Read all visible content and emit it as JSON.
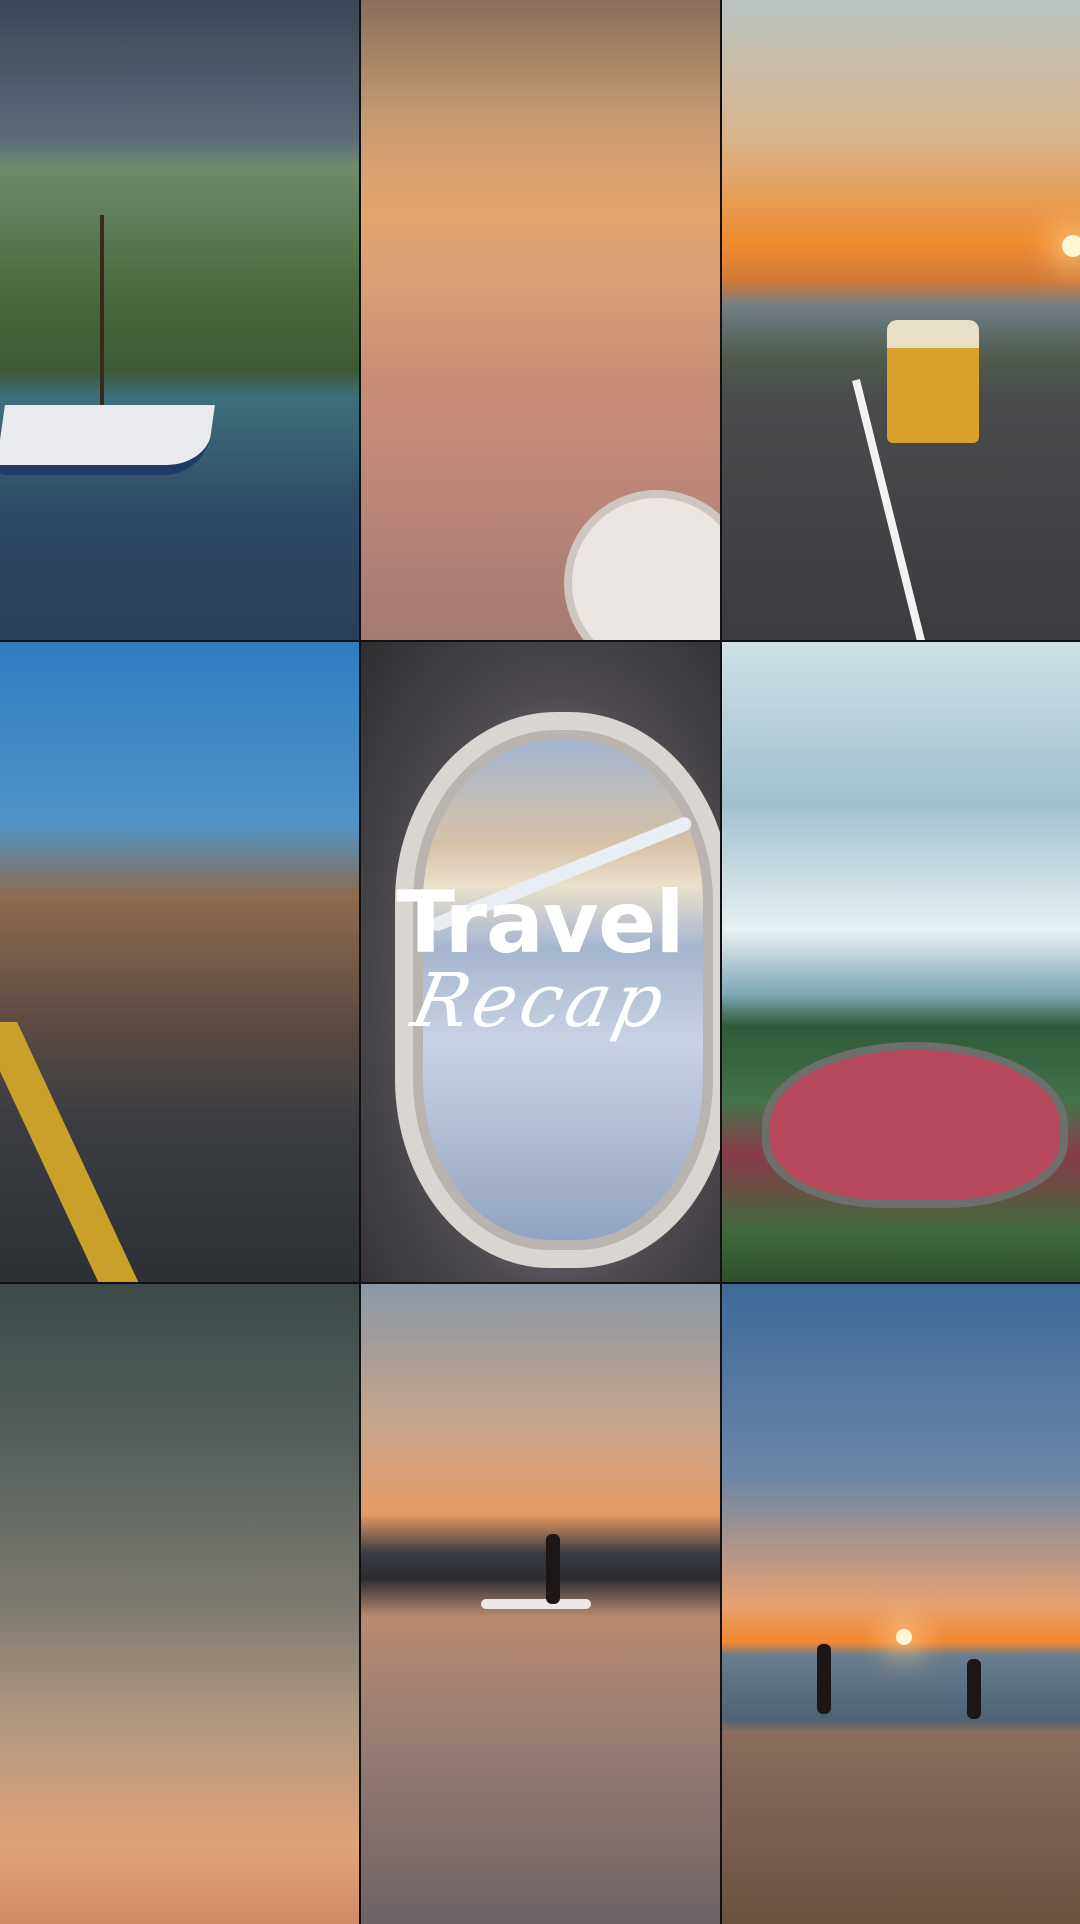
{
  "title": {
    "line1": "Travel",
    "line2": "Recap"
  },
  "colors": {
    "title_text": "#ffffff"
  },
  "photos": [
    {
      "id": "sailboat-bay"
    },
    {
      "id": "clouds-from-plane"
    },
    {
      "id": "van-coastal-road"
    },
    {
      "id": "train-station"
    },
    {
      "id": "airplane-window"
    },
    {
      "id": "waves-amphitheatre"
    },
    {
      "id": "birds-dusk-sky"
    },
    {
      "id": "paddleboard-sunset"
    },
    {
      "id": "beach-sunset"
    }
  ]
}
